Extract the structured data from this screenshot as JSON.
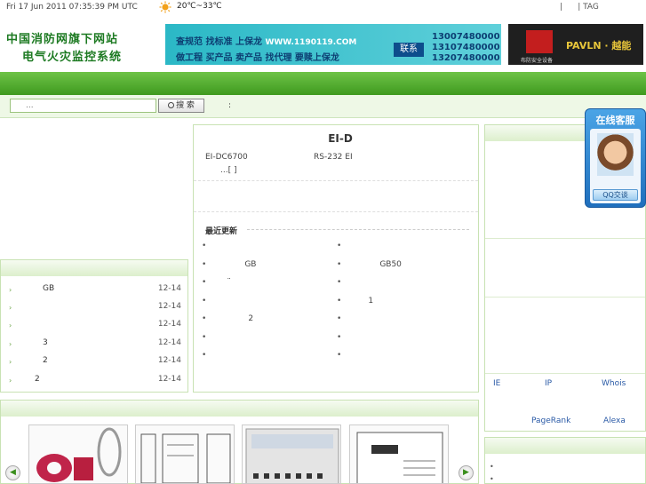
{
  "top": {
    "date": "Fri 17 Jun 2011 07:35:39 PM UTC",
    "weather": "20℃~33℃",
    "tag_links": "|      | TAG"
  },
  "header": {
    "logo_line1": "中国消防网旗下网站",
    "logo_line2": "电气火灾监控系统",
    "banner_line1": "查规范  找标准  上保龙",
    "banner_url": "WWW.1190119.COM",
    "banner_line2": "做工程  买产品  卖产品  找代理  要赎上保龙",
    "banner_contact": "联系",
    "phones": [
      "13007480000",
      "13107480000",
      "13207480000"
    ],
    "ad2_brand": "PAVLN · 越能",
    "ad2_caption": "布防安全设备"
  },
  "search": {
    "placeholder": "...",
    "button_label": "搜 索",
    "colon": ":"
  },
  "left_list": [
    {
      "title": "GB",
      "date": "12-14"
    },
    {
      "title": "",
      "date": "12-14"
    },
    {
      "title": "",
      "date": "12-14"
    },
    {
      "title": "3",
      "date": "12-14"
    },
    {
      "title": "2",
      "date": "12-14"
    },
    {
      "title": "2",
      "date": "12-14"
    }
  ],
  "main": {
    "title": "EI-D",
    "text1": "EI-DC6700",
    "text2": "RS-232   EI",
    "text3": "...[   ]",
    "latest_label": "最近更新",
    "left_bullets": [
      "",
      "GB",
      "¨",
      "",
      "2",
      "",
      ""
    ],
    "right_bullets": [
      "",
      "GB50",
      "",
      "1",
      "",
      "",
      ""
    ]
  },
  "right_panel": {
    "links": [
      "IE",
      "IP",
      "Whois",
      "PageRank",
      "Alexa"
    ]
  },
  "qq": {
    "title": "在线客服",
    "button": "QQ交谈"
  },
  "carousel": {
    "prev": "◀",
    "next": "▶"
  }
}
